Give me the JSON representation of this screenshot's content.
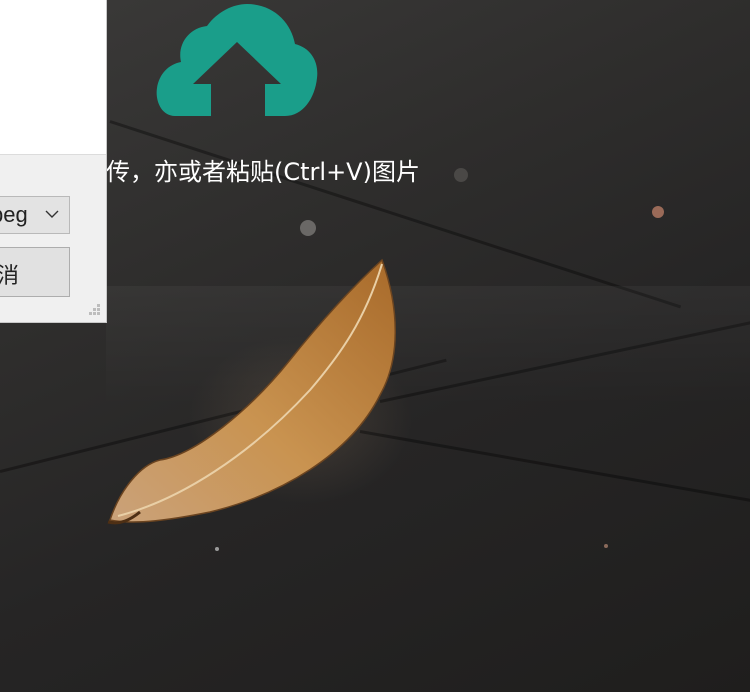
{
  "upload_area": {
    "icon": "cloud-upload-icon",
    "hint_text": "传，亦或者粘贴(Ctrl+V)图片",
    "accent_color": "#1a9e8a"
  },
  "file_dialog": {
    "type_select_value": "peg",
    "cancel_label": "消"
  }
}
